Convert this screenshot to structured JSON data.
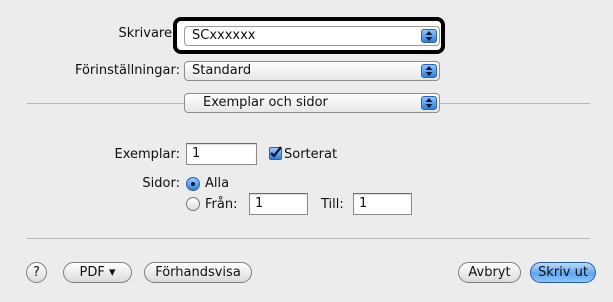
{
  "printer": {
    "label": "Skrivare",
    "value": "SCxxxxxx"
  },
  "presets": {
    "label": "Förinställningar:",
    "value": "Standard"
  },
  "section": {
    "value": "Exemplar och sidor"
  },
  "copies": {
    "label": "Exemplar:",
    "value": "1",
    "collate_label": "Sorterat",
    "collate_checked": true
  },
  "pages": {
    "label": "Sidor:",
    "all_label": "Alla",
    "from_label": "Från:",
    "from_value": "1",
    "to_label": "Till:",
    "to_value": "1",
    "selected": "all"
  },
  "footer": {
    "help_label": "?",
    "pdf_label": "PDF ▾",
    "preview_label": "Förhandsvisa",
    "cancel_label": "Avbryt",
    "print_label": "Skriv ut"
  },
  "colors": {
    "accent": "#2f7fe0",
    "background": "#ececec"
  }
}
